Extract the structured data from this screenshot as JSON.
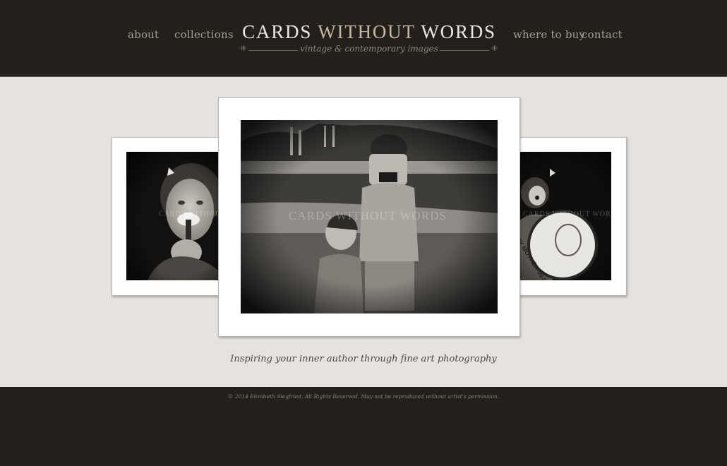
{
  "nav": {
    "about": "about",
    "collections": "collections",
    "where_to_buy": "where to buy",
    "contact": "contact"
  },
  "logo": {
    "title_part1": "CARDS ",
    "title_part2": "WITHOUT",
    "title_part3": " WORDS",
    "subtitle": "vintage & contemporary images",
    "ornament_left": "⁜",
    "ornament_right": "⁜"
  },
  "slides": {
    "left": {
      "watermark": "CARDS WITHOUT WORDS"
    },
    "center": {
      "watermark": "CARDS WITHOUT WORDS"
    },
    "right": {
      "watermark": "CARDS WITHOUT WORDS",
      "drum_text": "MY MOTHER-IN-LAW"
    }
  },
  "tagline": "Inspiring your inner author through fine art photography",
  "footer": "© 2014 Elizabeth Siegfried. All Rights Reserved. May not be reproduced without artist's permission.",
  "colors": {
    "header_bg": "#23201c",
    "band_bg": "#e5e2df",
    "nav_text": "#a59d8f",
    "title_light": "#ebe7e1",
    "title_accent": "#c7b7a3"
  }
}
